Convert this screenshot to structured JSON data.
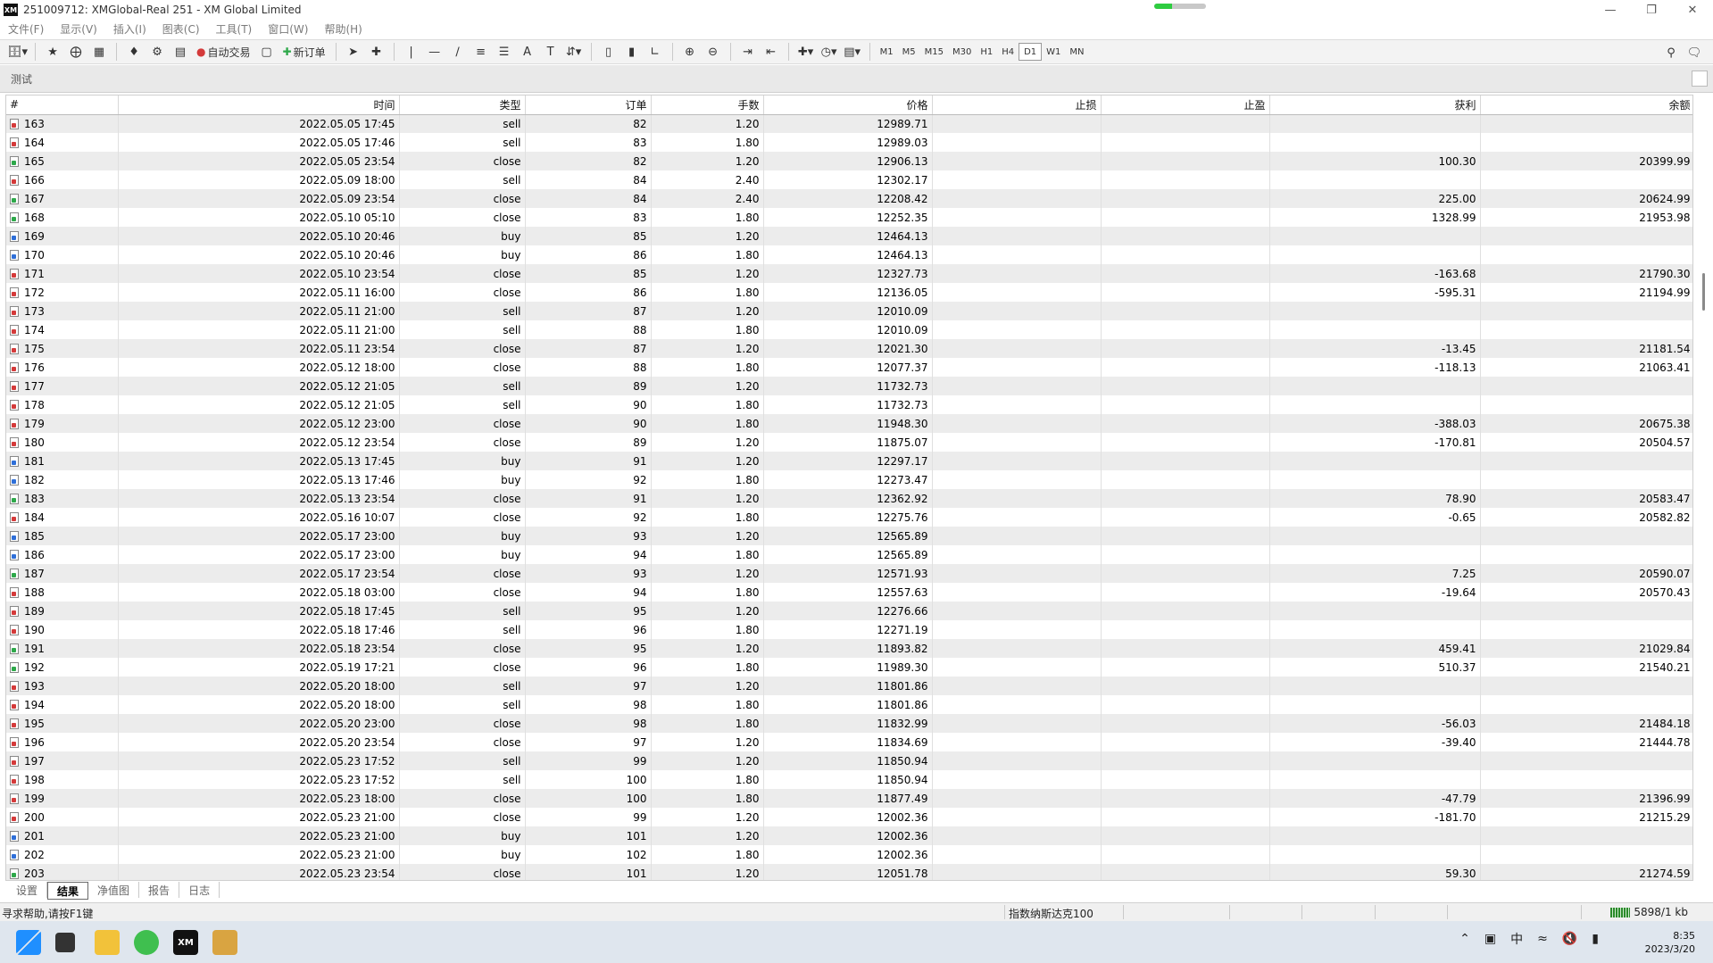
{
  "window": {
    "title": "251009712: XMGlobal-Real 251 - XM Global Limited",
    "logo": "XM"
  },
  "menu": [
    "文件(F)",
    "显示(V)",
    "插入(I)",
    "图表(C)",
    "工具(T)",
    "窗口(W)",
    "帮助(H)"
  ],
  "toolbar": {
    "auto_trade_label": "自动交易",
    "new_order_label": "新订单",
    "timeframes": [
      "M1",
      "M5",
      "M15",
      "M30",
      "H1",
      "H4",
      "D1",
      "W1",
      "MN"
    ],
    "active_timeframe": "D1"
  },
  "panel": {
    "label": "测试"
  },
  "table": {
    "columns": [
      "#",
      "时间",
      "类型",
      "订单",
      "手数",
      "价格",
      "止损",
      "止盈",
      "获利",
      "余额"
    ],
    "rows": [
      [
        "163",
        "2022.05.05 17:45",
        "sell",
        "82",
        "1.20",
        "12989.71",
        "",
        "",
        "",
        ""
      ],
      [
        "164",
        "2022.05.05 17:46",
        "sell",
        "83",
        "1.80",
        "12989.03",
        "",
        "",
        "",
        ""
      ],
      [
        "165",
        "2022.05.05 23:54",
        "close",
        "82",
        "1.20",
        "12906.13",
        "",
        "",
        "100.30",
        "20399.99"
      ],
      [
        "166",
        "2022.05.09 18:00",
        "sell",
        "84",
        "2.40",
        "12302.17",
        "",
        "",
        "",
        ""
      ],
      [
        "167",
        "2022.05.09 23:54",
        "close",
        "84",
        "2.40",
        "12208.42",
        "",
        "",
        "225.00",
        "20624.99"
      ],
      [
        "168",
        "2022.05.10 05:10",
        "close",
        "83",
        "1.80",
        "12252.35",
        "",
        "",
        "1328.99",
        "21953.98"
      ],
      [
        "169",
        "2022.05.10 20:46",
        "buy",
        "85",
        "1.20",
        "12464.13",
        "",
        "",
        "",
        ""
      ],
      [
        "170",
        "2022.05.10 20:46",
        "buy",
        "86",
        "1.80",
        "12464.13",
        "",
        "",
        "",
        ""
      ],
      [
        "171",
        "2022.05.10 23:54",
        "close",
        "85",
        "1.20",
        "12327.73",
        "",
        "",
        "-163.68",
        "21790.30"
      ],
      [
        "172",
        "2022.05.11 16:00",
        "close",
        "86",
        "1.80",
        "12136.05",
        "",
        "",
        "-595.31",
        "21194.99"
      ],
      [
        "173",
        "2022.05.11 21:00",
        "sell",
        "87",
        "1.20",
        "12010.09",
        "",
        "",
        "",
        ""
      ],
      [
        "174",
        "2022.05.11 21:00",
        "sell",
        "88",
        "1.80",
        "12010.09",
        "",
        "",
        "",
        ""
      ],
      [
        "175",
        "2022.05.11 23:54",
        "close",
        "87",
        "1.20",
        "12021.30",
        "",
        "",
        "-13.45",
        "21181.54"
      ],
      [
        "176",
        "2022.05.12 18:00",
        "close",
        "88",
        "1.80",
        "12077.37",
        "",
        "",
        "-118.13",
        "21063.41"
      ],
      [
        "177",
        "2022.05.12 21:05",
        "sell",
        "89",
        "1.20",
        "11732.73",
        "",
        "",
        "",
        ""
      ],
      [
        "178",
        "2022.05.12 21:05",
        "sell",
        "90",
        "1.80",
        "11732.73",
        "",
        "",
        "",
        ""
      ],
      [
        "179",
        "2022.05.12 23:00",
        "close",
        "90",
        "1.80",
        "11948.30",
        "",
        "",
        "-388.03",
        "20675.38"
      ],
      [
        "180",
        "2022.05.12 23:54",
        "close",
        "89",
        "1.20",
        "11875.07",
        "",
        "",
        "-170.81",
        "20504.57"
      ],
      [
        "181",
        "2022.05.13 17:45",
        "buy",
        "91",
        "1.20",
        "12297.17",
        "",
        "",
        "",
        ""
      ],
      [
        "182",
        "2022.05.13 17:46",
        "buy",
        "92",
        "1.80",
        "12273.47",
        "",
        "",
        "",
        ""
      ],
      [
        "183",
        "2022.05.13 23:54",
        "close",
        "91",
        "1.20",
        "12362.92",
        "",
        "",
        "78.90",
        "20583.47"
      ],
      [
        "184",
        "2022.05.16 10:07",
        "close",
        "92",
        "1.80",
        "12275.76",
        "",
        "",
        "-0.65",
        "20582.82"
      ],
      [
        "185",
        "2022.05.17 23:00",
        "buy",
        "93",
        "1.20",
        "12565.89",
        "",
        "",
        "",
        ""
      ],
      [
        "186",
        "2022.05.17 23:00",
        "buy",
        "94",
        "1.80",
        "12565.89",
        "",
        "",
        "",
        ""
      ],
      [
        "187",
        "2022.05.17 23:54",
        "close",
        "93",
        "1.20",
        "12571.93",
        "",
        "",
        "7.25",
        "20590.07"
      ],
      [
        "188",
        "2022.05.18 03:00",
        "close",
        "94",
        "1.80",
        "12557.63",
        "",
        "",
        "-19.64",
        "20570.43"
      ],
      [
        "189",
        "2022.05.18 17:45",
        "sell",
        "95",
        "1.20",
        "12276.66",
        "",
        "",
        "",
        ""
      ],
      [
        "190",
        "2022.05.18 17:46",
        "sell",
        "96",
        "1.80",
        "12271.19",
        "",
        "",
        "",
        ""
      ],
      [
        "191",
        "2022.05.18 23:54",
        "close",
        "95",
        "1.20",
        "11893.82",
        "",
        "",
        "459.41",
        "21029.84"
      ],
      [
        "192",
        "2022.05.19 17:21",
        "close",
        "96",
        "1.80",
        "11989.30",
        "",
        "",
        "510.37",
        "21540.21"
      ],
      [
        "193",
        "2022.05.20 18:00",
        "sell",
        "97",
        "1.20",
        "11801.86",
        "",
        "",
        "",
        ""
      ],
      [
        "194",
        "2022.05.20 18:00",
        "sell",
        "98",
        "1.80",
        "11801.86",
        "",
        "",
        "",
        ""
      ],
      [
        "195",
        "2022.05.20 23:00",
        "close",
        "98",
        "1.80",
        "11832.99",
        "",
        "",
        "-56.03",
        "21484.18"
      ],
      [
        "196",
        "2022.05.20 23:54",
        "close",
        "97",
        "1.20",
        "11834.69",
        "",
        "",
        "-39.40",
        "21444.78"
      ],
      [
        "197",
        "2022.05.23 17:52",
        "sell",
        "99",
        "1.20",
        "11850.94",
        "",
        "",
        "",
        ""
      ],
      [
        "198",
        "2022.05.23 17:52",
        "sell",
        "100",
        "1.80",
        "11850.94",
        "",
        "",
        "",
        ""
      ],
      [
        "199",
        "2022.05.23 18:00",
        "close",
        "100",
        "1.80",
        "11877.49",
        "",
        "",
        "-47.79",
        "21396.99"
      ],
      [
        "200",
        "2022.05.23 21:00",
        "close",
        "99",
        "1.20",
        "12002.36",
        "",
        "",
        "-181.70",
        "21215.29"
      ],
      [
        "201",
        "2022.05.23 21:00",
        "buy",
        "101",
        "1.20",
        "12002.36",
        "",
        "",
        "",
        ""
      ],
      [
        "202",
        "2022.05.23 21:00",
        "buy",
        "102",
        "1.80",
        "12002.36",
        "",
        "",
        "",
        ""
      ],
      [
        "203",
        "2022.05.23 23:54",
        "close",
        "101",
        "1.20",
        "12051.78",
        "",
        "",
        "59.30",
        "21274.59"
      ]
    ]
  },
  "tabs": [
    "设置",
    "结果",
    "净值图",
    "报告",
    "日志"
  ],
  "active_tab": "结果",
  "status": {
    "help": "寻求帮助,请按F1键",
    "symbol": "指数纳斯达克100",
    "traffic": "5898/1 kb"
  },
  "clock": {
    "time": "8:35",
    "date": "2023/3/20"
  },
  "colors": {
    "sell_icon": "#d43a3a",
    "buy_icon": "#2f6fd8",
    "profit_icon": "#2ea84a",
    "row_alt": "#ececec"
  }
}
